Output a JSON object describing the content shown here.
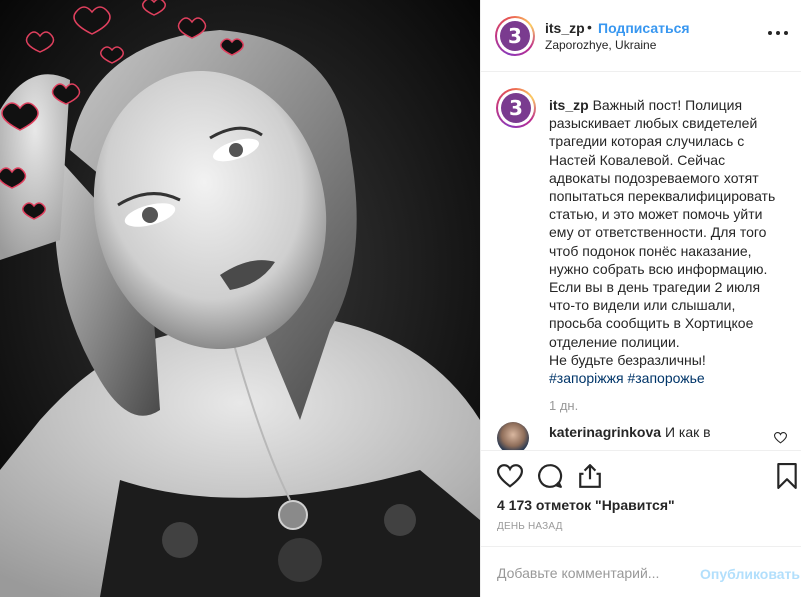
{
  "header": {
    "username": "its_zp",
    "separator": "•",
    "follow_label": "Подписаться",
    "location": "Zaporozhye, Ukraine",
    "avatar_letter": "3"
  },
  "caption": {
    "username": "its_zp",
    "text": "Важный пост! Полиция разыскивает любых свидетелей трагедии которая случилась с Настей Ковалевой. Сейчас адвокаты подозреваемого хотят попытаться переквалифицировать статью, и это может помочь уйти ему от ответственности. Для того чтоб подонок понёс наказание, нужно собрать всю информацию. Если вы в день трагедии 2 июля что-то видели или слышали, просьба сообщить в Хортицкое отделение полиции.\nНе будьте безразличны!",
    "hashtags": "#запоріжжя #запорожье",
    "time": "1 дн."
  },
  "comment": {
    "username": "katerinagrinkova",
    "text": "И как в"
  },
  "likes_text": "4 173 отметок \"Нравится\"",
  "date_text": "день назад",
  "comment_box": {
    "placeholder": "Добавьте комментарий...",
    "publish_label": "Опубликовать"
  },
  "icons": [
    "more-icon",
    "heart-icon",
    "comment-icon",
    "share-icon",
    "bookmark-icon"
  ],
  "colors": {
    "link": "#3897f0",
    "hashtag": "#003569",
    "muted": "#999999",
    "publish_disabled": "#b2dffc"
  }
}
